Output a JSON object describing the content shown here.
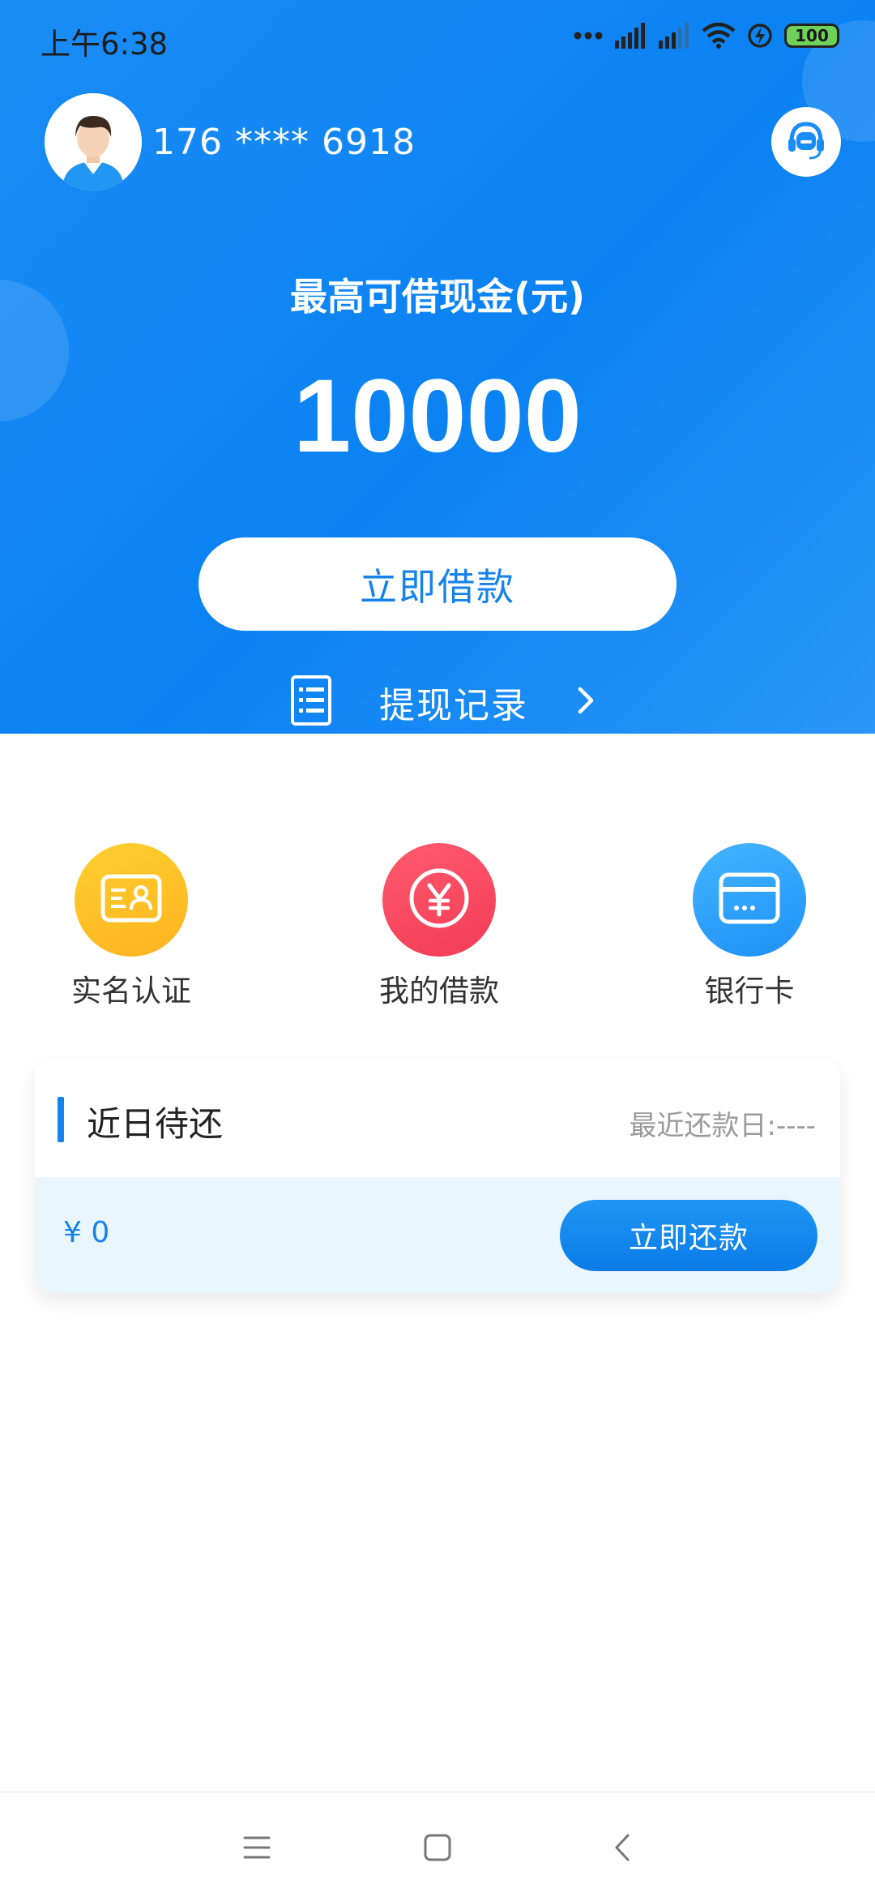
{
  "status_bar": {
    "time": "上午6:38",
    "battery_level": "100",
    "icons": [
      "more-dots-icon",
      "signal-icon",
      "signal-weak-icon",
      "wifi-icon",
      "charging-icon",
      "battery-icon"
    ]
  },
  "header": {
    "phone": "176 **** 6918",
    "max_label": "最高可借现金(元)",
    "max_amount": "10000",
    "borrow_button": "立即借款",
    "withdraw_record": "提现记录",
    "colors": {
      "background": "#0b82f3",
      "accent": "#1683ea"
    }
  },
  "shortcuts": [
    {
      "label": "实名认证",
      "icon": "id-card-icon",
      "color": "#ffc226"
    },
    {
      "label": "我的借款",
      "icon": "yen-coin-icon",
      "color": "#f54a61"
    },
    {
      "label": "银行卡",
      "icon": "bank-card-icon",
      "color": "#2ea3fa"
    }
  ],
  "repayment_card": {
    "title": "近日待还",
    "latest_date": "最近还款日:----",
    "amount": "¥ 0",
    "repay_button": "立即还款"
  },
  "nav": {
    "icons": [
      "menu-icon",
      "home-square-icon",
      "back-chevron-icon"
    ]
  }
}
